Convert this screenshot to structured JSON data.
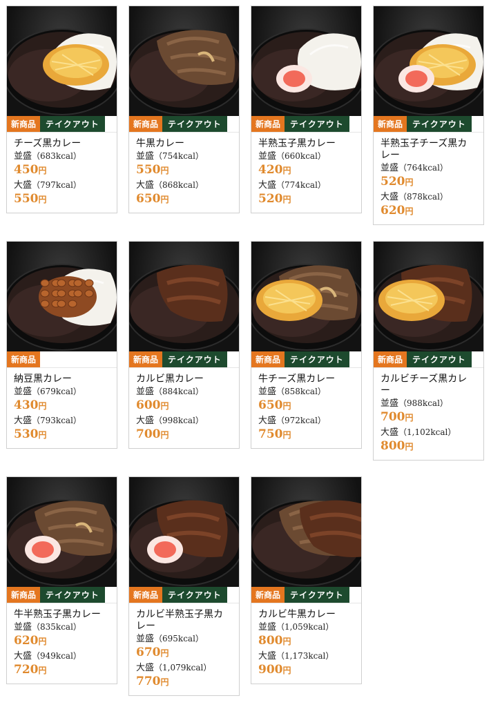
{
  "tags": {
    "new": "新商品",
    "takeout": "テイクアウト"
  },
  "units": {
    "yen": "円"
  },
  "colors": {
    "price": "#e08a2e",
    "new_tag": "#e4761f",
    "takeout_tag": "#1d4a2e"
  },
  "items": [
    {
      "name": "チーズ黒カレー",
      "regular_label": "並盛",
      "regular_kcal": "（683kcal）",
      "regular_price": "450",
      "large_label": "大盛",
      "large_kcal": "（797kcal）",
      "large_price": "550",
      "takeout": true,
      "image": "cheese-curry"
    },
    {
      "name": "牛黒カレー",
      "regular_label": "並盛",
      "regular_kcal": "（754kcal）",
      "regular_price": "550",
      "large_label": "大盛",
      "large_kcal": "（868kcal）",
      "large_price": "650",
      "takeout": true,
      "image": "beef-curry"
    },
    {
      "name": "半熟玉子黒カレー",
      "regular_label": "並盛",
      "regular_kcal": "（660kcal）",
      "regular_price": "420",
      "large_label": "大盛",
      "large_kcal": "（774kcal）",
      "large_price": "520",
      "takeout": true,
      "image": "egg-curry"
    },
    {
      "name": "半熟玉子チーズ黒カレー",
      "regular_label": "並盛",
      "regular_kcal": "（764kcal）",
      "regular_price": "520",
      "large_label": "大盛",
      "large_kcal": "（878kcal）",
      "large_price": "620",
      "takeout": true,
      "image": "egg-cheese-curry"
    },
    {
      "name": "納豆黒カレー",
      "regular_label": "並盛",
      "regular_kcal": "（679kcal）",
      "regular_price": "430",
      "large_label": "大盛",
      "large_kcal": "（793kcal）",
      "large_price": "530",
      "takeout": false,
      "image": "natto-curry"
    },
    {
      "name": "カルビ黒カレー",
      "regular_label": "並盛",
      "regular_kcal": "（884kcal）",
      "regular_price": "600",
      "large_label": "大盛",
      "large_kcal": "（998kcal）",
      "large_price": "700",
      "takeout": true,
      "image": "kalbi-curry"
    },
    {
      "name": "牛チーズ黒カレー",
      "regular_label": "並盛",
      "regular_kcal": "（858kcal）",
      "regular_price": "650",
      "large_label": "大盛",
      "large_kcal": "（972kcal）",
      "large_price": "750",
      "takeout": true,
      "image": "beef-cheese-curry"
    },
    {
      "name": "カルビチーズ黒カレー",
      "regular_label": "並盛",
      "regular_kcal": "（988kcal）",
      "regular_price": "700",
      "large_label": "大盛",
      "large_kcal": "（1,102kcal）",
      "large_price": "800",
      "takeout": true,
      "image": "kalbi-cheese-curry"
    },
    {
      "name": "牛半熟玉子黒カレー",
      "regular_label": "並盛",
      "regular_kcal": "（835kcal）",
      "regular_price": "620",
      "large_label": "大盛",
      "large_kcal": "（949kcal）",
      "large_price": "720",
      "takeout": true,
      "image": "beef-egg-curry"
    },
    {
      "name": "カルビ半熟玉子黒カレー",
      "regular_label": "並盛",
      "regular_kcal": "（695kcal）",
      "regular_price": "670",
      "large_label": "大盛",
      "large_kcal": "（1,079kcal）",
      "large_price": "770",
      "takeout": true,
      "image": "kalbi-egg-curry"
    },
    {
      "name": "カルビ牛黒カレー",
      "regular_label": "並盛",
      "regular_kcal": "（1,059kcal）",
      "regular_price": "800",
      "large_label": "大盛",
      "large_kcal": "（1,173kcal）",
      "large_price": "900",
      "takeout": true,
      "image": "kalbi-beef-curry"
    }
  ]
}
